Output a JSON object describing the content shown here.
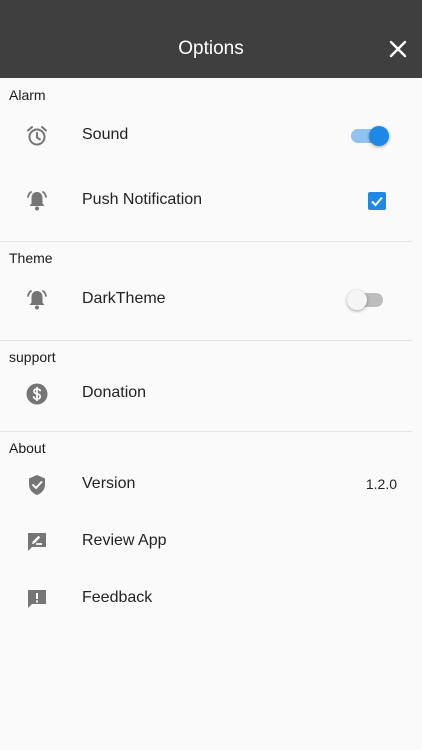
{
  "appbar": {
    "title": "Options"
  },
  "colors": {
    "appbar": "#3f3f3f",
    "accent": "#1e88e5",
    "icon": "#757575"
  },
  "sections": {
    "alarm": {
      "header": "Alarm",
      "sound": {
        "label": "Sound",
        "icon": "alarm-clock-icon",
        "enabled": true
      },
      "push": {
        "label": "Push Notification",
        "icon": "bell-icon",
        "checked": true
      }
    },
    "theme": {
      "header": "Theme",
      "dark": {
        "label": "DarkTheme",
        "icon": "bell-icon",
        "enabled": false
      }
    },
    "support": {
      "header": "support",
      "donation": {
        "label": "Donation",
        "icon": "dollar-icon"
      }
    },
    "about": {
      "header": "About",
      "version": {
        "label": "Version",
        "value": "1.2.0",
        "icon": "shield-check-icon"
      },
      "review": {
        "label": "Review App",
        "icon": "rate-review-icon"
      },
      "feedback": {
        "label": "Feedback",
        "icon": "feedback-icon"
      }
    }
  }
}
